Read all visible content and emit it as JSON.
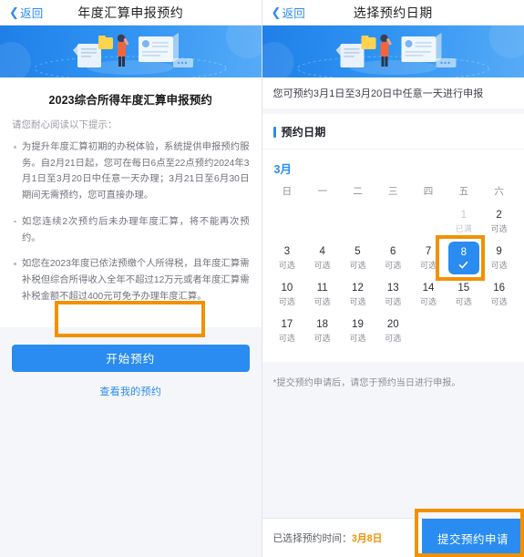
{
  "colors": {
    "primary_blue": "#2a8cf0",
    "highlight_orange": "#f29100",
    "page_bg": "#f5f6fa",
    "text_muted": "#8b8e96"
  },
  "left_screen": {
    "navbar": {
      "back_label": "返回",
      "back_icon": "chevron-left-icon",
      "title": "年度汇算申报预约"
    },
    "banner_icon": "tax-filing-illustration",
    "card_title": "2023综合所得年度汇算申报预约",
    "lead": "请您耐心阅读以下提示：",
    "tips": [
      "为提升年度汇算初期的办税体验，系统提供申报预约服务。自2月21日起，您可在每日6点至22点预约2024年3月1日至3月20日中任意一天办理；3月21日至6月30日期间无需预约，您可直接办理。",
      "如您连续2次预约后未办理年度汇算，将不能再次预约。",
      "如您在2023年度已依法预缴个人所得税，且年度汇算需补税但综合所得收入全年不超过12万元或者年度汇算需补税金额不超过400元可免予办理年度汇算。"
    ],
    "start_button": "开始预约",
    "view_link": "查看我的预约"
  },
  "right_screen": {
    "navbar": {
      "back_label": "返回",
      "back_icon": "chevron-left-icon",
      "title": "选择预约日期"
    },
    "banner_icon": "tax-filing-illustration",
    "notice": "您可预约3月1日至3月20日中任意一天进行申报",
    "section_title": "预约日期",
    "month_label": "3月",
    "weekdays": [
      "日",
      "一",
      "二",
      "三",
      "四",
      "五",
      "六"
    ],
    "calendar": [
      {
        "day": "",
        "status": "",
        "state": "empty"
      },
      {
        "day": "",
        "status": "",
        "state": "empty"
      },
      {
        "day": "",
        "status": "",
        "state": "empty"
      },
      {
        "day": "",
        "status": "",
        "state": "empty"
      },
      {
        "day": "",
        "status": "",
        "state": "empty"
      },
      {
        "day": "1",
        "status": "已满",
        "state": "full"
      },
      {
        "day": "2",
        "status": "可选",
        "state": "available"
      },
      {
        "day": "3",
        "status": "可选",
        "state": "available"
      },
      {
        "day": "4",
        "status": "可选",
        "state": "available"
      },
      {
        "day": "5",
        "status": "可选",
        "state": "available"
      },
      {
        "day": "6",
        "status": "可选",
        "state": "available"
      },
      {
        "day": "7",
        "status": "可选",
        "state": "available"
      },
      {
        "day": "8",
        "status": "",
        "state": "selected"
      },
      {
        "day": "9",
        "status": "可选",
        "state": "available"
      },
      {
        "day": "10",
        "status": "可选",
        "state": "available"
      },
      {
        "day": "11",
        "status": "可选",
        "state": "available"
      },
      {
        "day": "12",
        "status": "可选",
        "state": "available"
      },
      {
        "day": "13",
        "status": "可选",
        "state": "available"
      },
      {
        "day": "14",
        "status": "可选",
        "state": "available"
      },
      {
        "day": "15",
        "status": "可选",
        "state": "available"
      },
      {
        "day": "16",
        "status": "可选",
        "state": "available"
      },
      {
        "day": "17",
        "status": "可选",
        "state": "available"
      },
      {
        "day": "18",
        "status": "可选",
        "state": "available"
      },
      {
        "day": "19",
        "status": "可选",
        "state": "available"
      },
      {
        "day": "20",
        "status": "可选",
        "state": "available"
      },
      {
        "day": "",
        "status": "",
        "state": "empty"
      },
      {
        "day": "",
        "status": "",
        "state": "empty"
      },
      {
        "day": "",
        "status": "",
        "state": "empty"
      }
    ],
    "foot_note": "*提交预约申请后，请您于预约当日进行申报。",
    "bottom": {
      "selected_prefix": "已选择预约时间：",
      "selected_value": "3月8日",
      "submit_label": "提交预约申请"
    }
  },
  "annotations": {
    "start_button_box": "highlight-start-button",
    "day8_box": "highlight-selected-day",
    "submit_box": "highlight-submit-button"
  }
}
